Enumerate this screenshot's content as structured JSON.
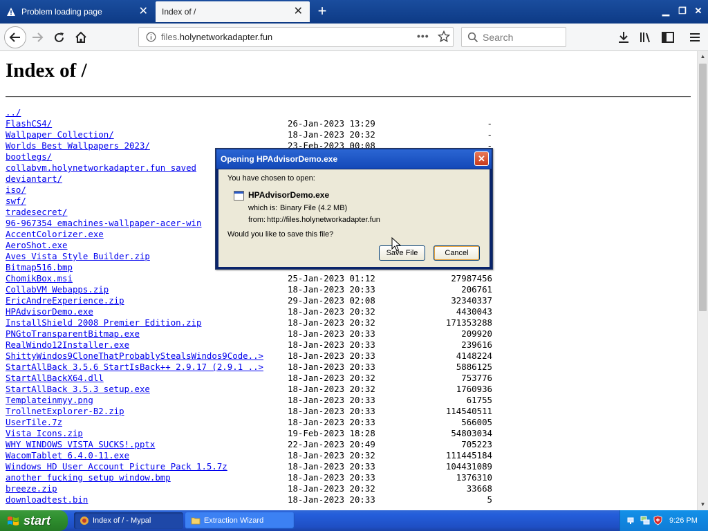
{
  "browser": {
    "tabs": [
      {
        "label": "Problem loading page",
        "has_warning_icon": true
      },
      {
        "label": "Index of /",
        "active": true
      }
    ],
    "new_tab_label": "+",
    "url": {
      "prefix": "files.",
      "domain": "holynetworkadapter.fun",
      "more": "•••"
    },
    "search_placeholder": "Search"
  },
  "page": {
    "heading": "Index of /",
    "entries": [
      {
        "name": "../",
        "date": "",
        "size": ""
      },
      {
        "name": "FlashCS4/",
        "date": "26-Jan-2023 13:29",
        "size": "-"
      },
      {
        "name": "Wallpaper Collection/",
        "date": "18-Jan-2023 20:32",
        "size": "-"
      },
      {
        "name": "Worlds Best Wallpapers 2023/",
        "date": "23-Feb-2023 00:08",
        "size": "-"
      },
      {
        "name": "bootlegs/",
        "date": "",
        "size": ""
      },
      {
        "name": "collabvm.holynetworkadapter.fun saved",
        "date": "",
        "size": ""
      },
      {
        "name": "deviantart/",
        "date": "",
        "size": ""
      },
      {
        "name": "iso/",
        "date": "",
        "size": ""
      },
      {
        "name": "swf/",
        "date": "",
        "size": ""
      },
      {
        "name": "tradesecret/",
        "date": "",
        "size": ""
      },
      {
        "name": "96-967354 emachines-wallpaper-acer-win",
        "date": "",
        "size": ""
      },
      {
        "name": "AccentColorizer.exe",
        "date": "",
        "size": ""
      },
      {
        "name": "AeroShot.exe",
        "date": "",
        "size": ""
      },
      {
        "name": "Aves Vista Style Builder.zip",
        "date": "",
        "size": ""
      },
      {
        "name": "Bitmap516.bmp",
        "date": "",
        "size": ""
      },
      {
        "name": "ChomikBox.msi",
        "date": "25-Jan-2023 01:12",
        "size": "27987456"
      },
      {
        "name": "CollabVM Webapps.zip",
        "date": "18-Jan-2023 20:33",
        "size": "206761"
      },
      {
        "name": "EricAndreExperience.zip",
        "date": "29-Jan-2023 02:08",
        "size": "32340337"
      },
      {
        "name": "HPAdvisorDemo.exe",
        "date": "18-Jan-2023 20:32",
        "size": "4430043"
      },
      {
        "name": "InstallShield 2008 Premier Edition.zip",
        "date": "18-Jan-2023 20:32",
        "size": "171353288"
      },
      {
        "name": "PNGtoTransparentBitmap.exe",
        "date": "18-Jan-2023 20:33",
        "size": "209920"
      },
      {
        "name": "RealWindo12Installer.exe",
        "date": "18-Jan-2023 20:33",
        "size": "239616"
      },
      {
        "name": "ShittyWindos9CloneThatProbablyStealsWindos9Code..>",
        "date": "18-Jan-2023 20:33",
        "size": "4148224"
      },
      {
        "name": "StartAllBack 3.5.6 StartIsBack++ 2.9.17 (2.9.1 ..>",
        "date": "18-Jan-2023 20:33",
        "size": "5886125"
      },
      {
        "name": "StartAllBackX64.dll",
        "date": "18-Jan-2023 20:32",
        "size": "753776"
      },
      {
        "name": "StartAllBack 3.5.3 setup.exe",
        "date": "18-Jan-2023 20:32",
        "size": "1760936"
      },
      {
        "name": "Templateinmyy.png",
        "date": "18-Jan-2023 20:33",
        "size": "61755"
      },
      {
        "name": "TrollnetExplorer-B2.zip",
        "date": "18-Jan-2023 20:33",
        "size": "114540511"
      },
      {
        "name": "UserTile.7z",
        "date": "18-Jan-2023 20:33",
        "size": "566005"
      },
      {
        "name": "Vista Icons.zip",
        "date": "19-Feb-2023 18:28",
        "size": "54803034"
      },
      {
        "name": "WHY WINDOWS VISTA SUCKS!.pptx",
        "date": "22-Jan-2023 20:49",
        "size": "705223"
      },
      {
        "name": "WacomTablet 6.4.0-11.exe",
        "date": "18-Jan-2023 20:32",
        "size": "111445184"
      },
      {
        "name": "Windows HD User Account Picture Pack 1.5.7z",
        "date": "18-Jan-2023 20:33",
        "size": "104431089"
      },
      {
        "name": "another fucking setup window.bmp",
        "date": "18-Jan-2023 20:33",
        "size": "1376310"
      },
      {
        "name": "breeze.zip",
        "date": "18-Jan-2023 20:32",
        "size": "33668"
      },
      {
        "name": "downloadtest.bin",
        "date": "18-Jan-2023 20:33",
        "size": "5"
      }
    ]
  },
  "dialog": {
    "title": "Opening HPAdvisorDemo.exe",
    "prompt": "You have chosen to open:",
    "filename": "HPAdvisorDemo.exe",
    "which_is_label": "which is:",
    "which_is_value": "Binary File (4.2 MB)",
    "from_label": "from:",
    "from_value": "http://files.holynetworkadapter.fun",
    "question": "Would you like to save this file?",
    "save_label": "Save File",
    "cancel_label": "Cancel",
    "close_label": "✕"
  },
  "taskbar": {
    "start_label": "start",
    "tasks": [
      {
        "label": "Index of / - Mypal",
        "active": true
      },
      {
        "label": "Extraction Wizard",
        "active": false
      }
    ],
    "clock": "9:26 PM"
  },
  "colors": {
    "link": "#0000ee",
    "xp_blue": "#245edb",
    "start_green": "#2f8f2f",
    "dialog_face": "#ece9d8"
  }
}
